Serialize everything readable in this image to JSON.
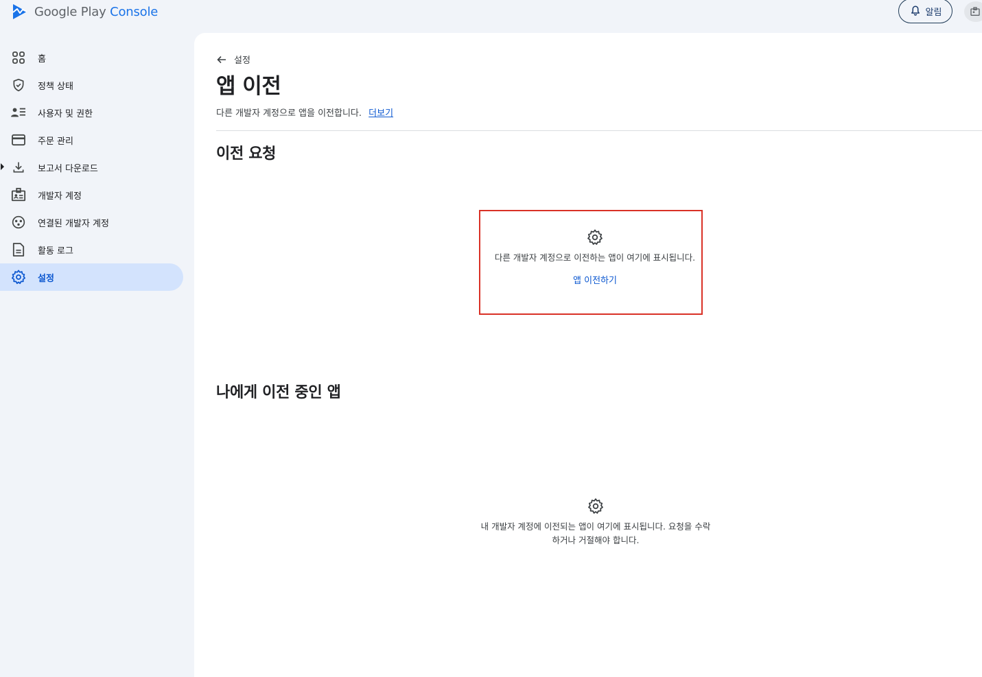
{
  "app": {
    "brand_google": "Google Play",
    "brand_console": "Console"
  },
  "topbar": {
    "notifications_label": "알림"
  },
  "sidebar": {
    "items": [
      {
        "label": "홈",
        "icon": "grid-icon"
      },
      {
        "label": "정책 상태",
        "icon": "shield-check-icon"
      },
      {
        "label": "사용자 및 권한",
        "icon": "users-list-icon"
      },
      {
        "label": "주문 관리",
        "icon": "credit-card-icon"
      },
      {
        "label": "보고서 다운로드",
        "icon": "download-icon"
      },
      {
        "label": "개발자 계정",
        "icon": "id-badge-icon"
      },
      {
        "label": "연결된 개발자 계정",
        "icon": "linked-accounts-icon"
      },
      {
        "label": "활동 로그",
        "icon": "document-icon"
      },
      {
        "label": "설정",
        "icon": "gear-icon",
        "active": true
      }
    ]
  },
  "main": {
    "back_label": "설정",
    "title": "앱 이전",
    "subtitle": "다른 개발자 계정으로 앱을 이전합니다.",
    "learn_more": "더보기",
    "transfer_requests": {
      "heading": "이전 요청",
      "empty_message": "다른 개발자 계정으로 이전하는 앱이 여기에 표시됩니다.",
      "action_label": "앱 이전하기"
    },
    "incoming": {
      "heading": "나에게 이전 중인 앱",
      "empty_message_line1": "내 개발자 계정에 이전되는 앱이 여기에 표시됩니다. 요청을 수락",
      "empty_message_line2": "하거나 거절해야 합니다."
    }
  },
  "colors": {
    "accent": "#0b57d0",
    "active_nav_bg": "#d3e3fd",
    "highlight_border": "#d93025"
  }
}
